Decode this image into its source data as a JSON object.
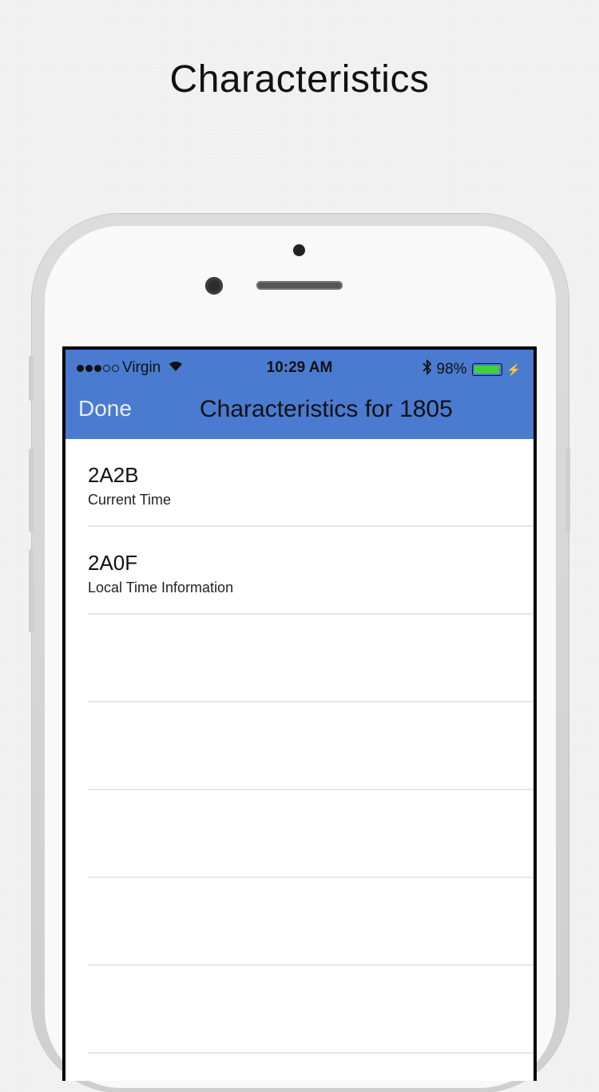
{
  "promo": {
    "title": "Characteristics"
  },
  "status_bar": {
    "carrier": "Virgin",
    "time": "10:29 AM",
    "battery": "98%",
    "battery_level": 0.98
  },
  "nav": {
    "done_label": "Done",
    "title": "Characteristics for 1805"
  },
  "characteristics": [
    {
      "uuid": "2A2B",
      "name": "Current Time"
    },
    {
      "uuid": "2A0F",
      "name": "Local Time Information"
    }
  ],
  "colors": {
    "nav_bar": "#4a7bd0",
    "battery_fill": "#3fd13f"
  },
  "icons": [
    "wifi-icon",
    "bluetooth-icon",
    "battery-icon",
    "signal-dots-icon"
  ]
}
